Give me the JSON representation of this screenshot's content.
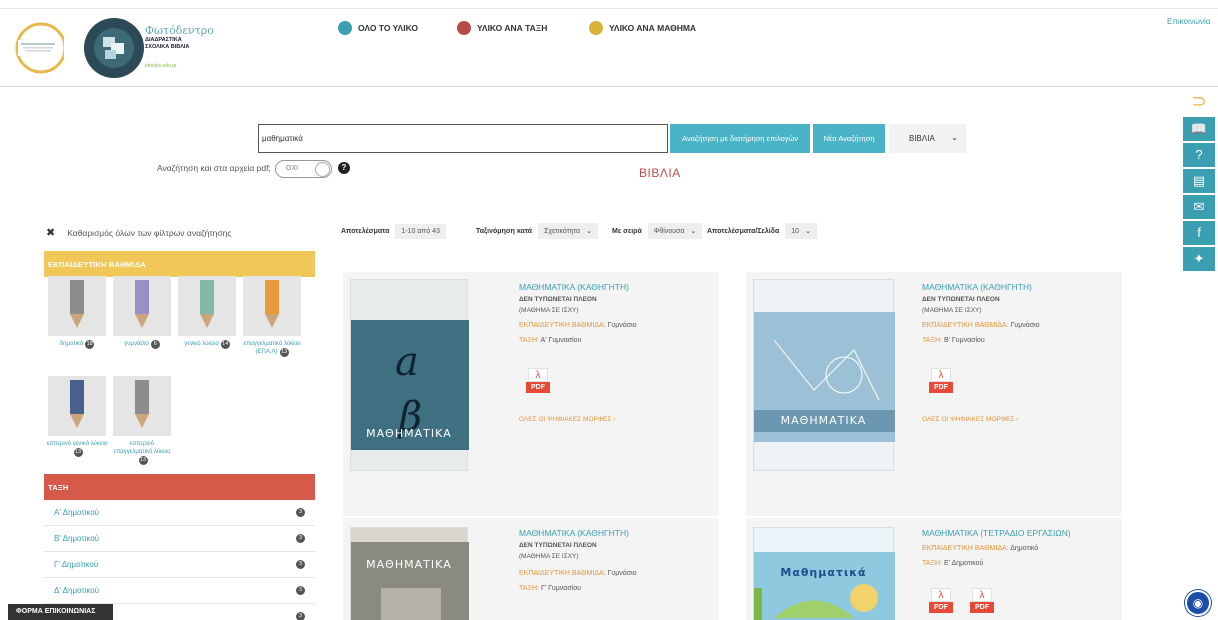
{
  "header": {
    "brand_title": "Φωτόδεντρο",
    "brand_sub": "ΔΙΑΔΡΑΣΤΙΚΑ ΣΧΟΛΙΚΑ ΒΙΒΛΙΑ",
    "brand_url": "ebooks.edu.gr",
    "contact": "Επικοινωνία",
    "nav": [
      {
        "label": "ΟΛΟ ΤΟ ΥΛΙΚΟ",
        "color": "#3a9fb0"
      },
      {
        "label": "ΥΛΙΚΟ ΑΝΑ ΤΑΞΗ",
        "color": "#b54b4b"
      },
      {
        "label": "ΥΛΙΚΟ ΑΝΑ ΜΑΘΗΜΑ",
        "color": "#d9b23a"
      }
    ]
  },
  "search": {
    "value": "μαθηματικά",
    "filter_button": "Αναζήτηση με διατήρηση επιλογών",
    "new_button": "Νέα Αναζήτηση",
    "type_select": "ΒΙΒΛΙΑ",
    "pdf_label": "Αναζήτηση και στα αρχεία pdf;",
    "pdf_toggle": "ΟΧΙ",
    "help": "?"
  },
  "section_title": "ΒΙΒΛΙΑ",
  "filters": {
    "clear": "Καθαρισμός όλων των φίλτρων αναζήτησης",
    "level_heading": "ΕΚΠΑΙΔΕΥΤΙΚΗ ΒΑΘΜΙΔΑ",
    "levels": [
      {
        "label": "δημοτικό",
        "count": "18",
        "color": "#8c8c8c"
      },
      {
        "label": "γυμνάσιο",
        "count": "6",
        "color": "#9a8fc7"
      },
      {
        "label": "γενικό λύκειο",
        "count": "14",
        "color": "#7fb7a8"
      },
      {
        "label": "επαγγελματικό λύκειο (ΕΠΑ.Λ)",
        "count": "13",
        "color": "#e89b3a"
      },
      {
        "label": "εσπερινό γενικό λύκειο",
        "count": "13",
        "color": "#4a5f8a"
      },
      {
        "label": "εσπερινό επαγγελματικό λύκειο",
        "count": "13",
        "color": "#8d8d8d"
      }
    ],
    "class_heading": "ΤΑΞΗ",
    "classes": [
      {
        "label": "Α' Δημοτικού",
        "count": "3"
      },
      {
        "label": "Β' Δημοτικού",
        "count": "3"
      },
      {
        "label": "Γ' Δημοτικού",
        "count": "3"
      },
      {
        "label": "Δ' Δημοτικού",
        "count": "3"
      },
      {
        "label": "",
        "count": "3"
      }
    ],
    "contact_form": "ΦΟΡΜΑ ΕΠΙΚΟΙΝΩΝΙΑΣ"
  },
  "results": {
    "label": "Αποτελέσματα",
    "range": "1-10 από 43",
    "sort_label": "Ταξινόμηση κατά",
    "sort_value": "Σχετικότητα",
    "order_label": "Με σειρά",
    "order_value": "Φθίνουσα",
    "per_page_label": "Αποτελέσματα/Σελίδα",
    "per_page_value": "10"
  },
  "books": [
    {
      "title": "ΜΑΘΗΜΑΤΙΚΑ (ΚΑΘΗΓΗΤΗ)",
      "note": "ΔΕΝ ΤΥΠΩΝΕΤΑΙ ΠΛΕΟΝ",
      "note2": "(ΜΑΘΗΜΑ ΣΕ ΙΣΧΥ)",
      "level_key": "ΕΚΠΑΙΔΕΥΤΙΚΗ ΒΑΘΜΙΔΑ:",
      "level_val": "Γυμνάσιο",
      "class_key": "ΤΑΞΗ:",
      "class_val": "Α' Γυμνασίου",
      "cover_text": "ΜΑΘΗΜΑΤΙΚΑ",
      "cover_color": "#3f7082",
      "pdf": [
        "PDF"
      ],
      "all_formats": "ΟΛΕΣ ΟΙ ΨΗΦΙΑΚΕΣ ΜΟΡΦΕΣ"
    },
    {
      "title": "ΜΑΘΗΜΑΤΙΚΑ (ΚΑΘΗΓΗΤΗ)",
      "note": "ΔΕΝ ΤΥΠΩΝΕΤΑΙ ΠΛΕΟΝ",
      "note2": "(ΜΑΘΗΜΑ ΣΕ ΙΣΧΥ)",
      "level_key": "ΕΚΠΑΙΔΕΥΤΙΚΗ ΒΑΘΜΙΔΑ:",
      "level_val": "Γυμνάσιο",
      "class_key": "ΤΑΞΗ:",
      "class_val": "Β' Γυμνασίου",
      "cover_text": "ΜΑΘΗΜΑΤΙΚΑ",
      "cover_color": "#7fa8c2",
      "pdf": [
        "PDF"
      ],
      "all_formats": "ΟΛΕΣ ΟΙ ΨΗΦΙΑΚΕΣ ΜΟΡΦΕΣ"
    },
    {
      "title": "ΜΑΘΗΜΑΤΙΚΑ (ΚΑΘΗΓΗΤΗ)",
      "note": "ΔΕΝ ΤΥΠΩΝΕΤΑΙ ΠΛΕΟΝ",
      "note2": "(ΜΑΘΗΜΑ ΣΕ ΙΣΧΥ)",
      "level_key": "ΕΚΠΑΙΔΕΥΤΙΚΗ ΒΑΘΜΙΔΑ:",
      "level_val": "Γυμνάσιο",
      "class_key": "ΤΑΞΗ:",
      "class_val": "Γ' Γυμνασίου",
      "cover_text": "ΜΑΘΗΜΑΤΙΚΑ",
      "cover_color": "#8a8a80"
    },
    {
      "title": "ΜΑΘΗΜΑΤΙΚΑ (ΤΕΤΡΑΔΙΟ ΕΡΓΑΣΙΩΝ)",
      "level_key": "ΕΚΠΑΙΔΕΥΤΙΚΗ ΒΑΘΜΙΔΑ:",
      "level_val": "Δημοτικό",
      "class_key": "ΤΑΞΗ:",
      "class_val": "Ε' Δημοτικού",
      "cover_text": "Μαθηματικά",
      "cover_color": "#8fc9e0",
      "pdf": [
        "PDF",
        "PDF"
      ]
    }
  ],
  "sidebar_icons": [
    "book-icon",
    "help-icon",
    "document-icon",
    "mail-icon",
    "facebook-icon",
    "twitter-icon"
  ]
}
